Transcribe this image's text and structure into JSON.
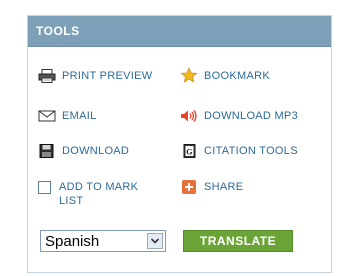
{
  "panel": {
    "title": "TOOLS"
  },
  "tools": {
    "print_preview": "PRINT PREVIEW",
    "bookmark": "BOOKMARK",
    "email": "EMAIL",
    "download_mp3": "DOWNLOAD MP3",
    "download": "DOWNLOAD",
    "citation_tools": "CITATION TOOLS",
    "add_to_mark_list": "ADD TO MARK LIST",
    "share": "SHARE"
  },
  "translate": {
    "selected_language": "Spanish",
    "button_label": "TRANSLATE"
  },
  "icons": {
    "print_preview": "printer-icon",
    "bookmark": "star-icon",
    "email": "envelope-icon",
    "download_mp3": "speaker-icon",
    "download": "floppy-disk-icon",
    "citation_tools": "citation-document-icon",
    "add_to_mark_list": "checkbox",
    "share": "plus-icon"
  },
  "colors": {
    "header_bg": "#7e9fb8",
    "link_text": "#2c6a9a",
    "panel_border": "#c3d3e1",
    "translate_button": "#6ba436",
    "share_icon": "#e8703a",
    "star_icon": "#f4b81e",
    "speaker_icon": "#e5452b"
  }
}
